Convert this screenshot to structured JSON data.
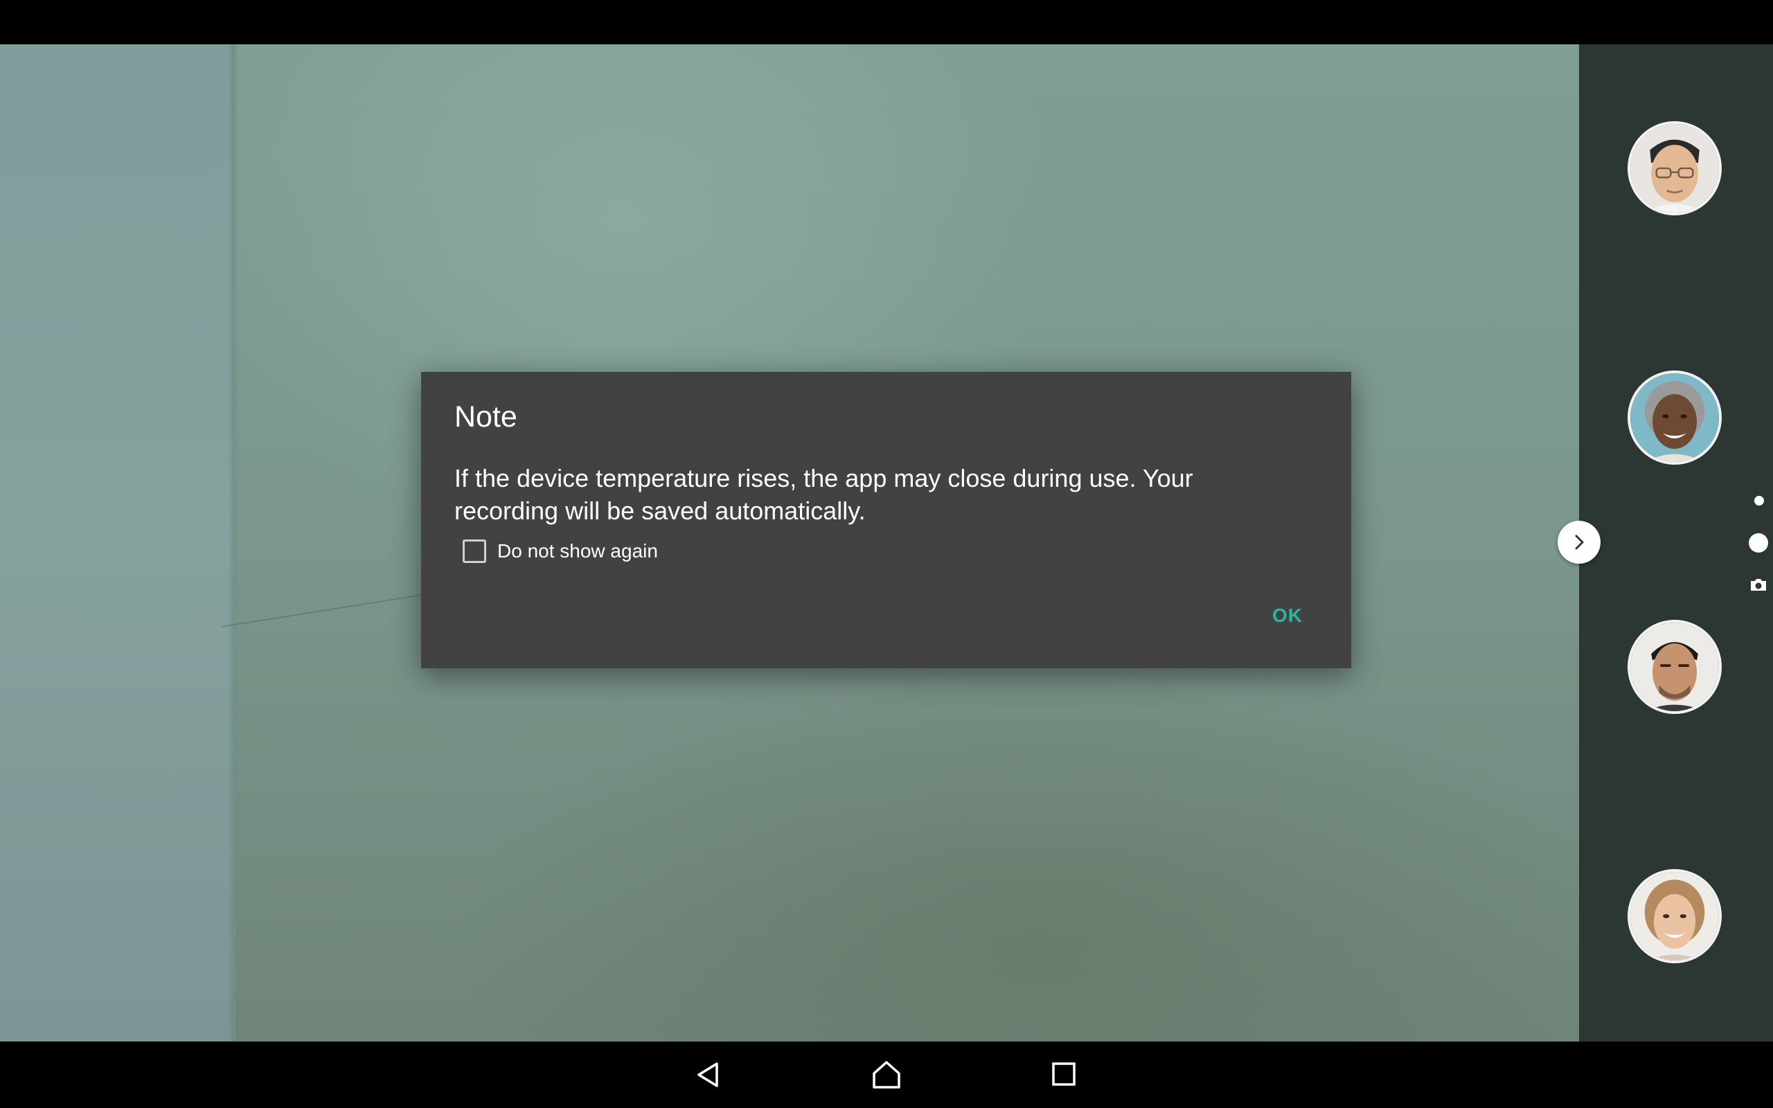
{
  "dialog": {
    "title": "Note",
    "message": "If the device temperature rises, the app may close during use. Your recording will be saved automatically.",
    "checkbox_label": "Do not show again",
    "checkbox_checked": false,
    "ok_label": "OK",
    "accent_color": "#26b8a3"
  },
  "side_panel": {
    "avatars": [
      {
        "icon": "avatar-older-man-glasses"
      },
      {
        "icon": "avatar-woman-gray-hair"
      },
      {
        "icon": "avatar-man-dark-hair"
      },
      {
        "icon": "avatar-young-woman"
      }
    ],
    "expand_icon": "chevron-right-icon",
    "mode_indicators": [
      "mode-dot-small",
      "mode-dot-large",
      "camera-icon"
    ]
  },
  "nav_bar": {
    "buttons": [
      "back-icon",
      "home-icon",
      "recents-icon"
    ]
  },
  "colors": {
    "dialog_background": "#424242",
    "side_panel_background": "#2c3633",
    "system_bars": "#000000"
  }
}
